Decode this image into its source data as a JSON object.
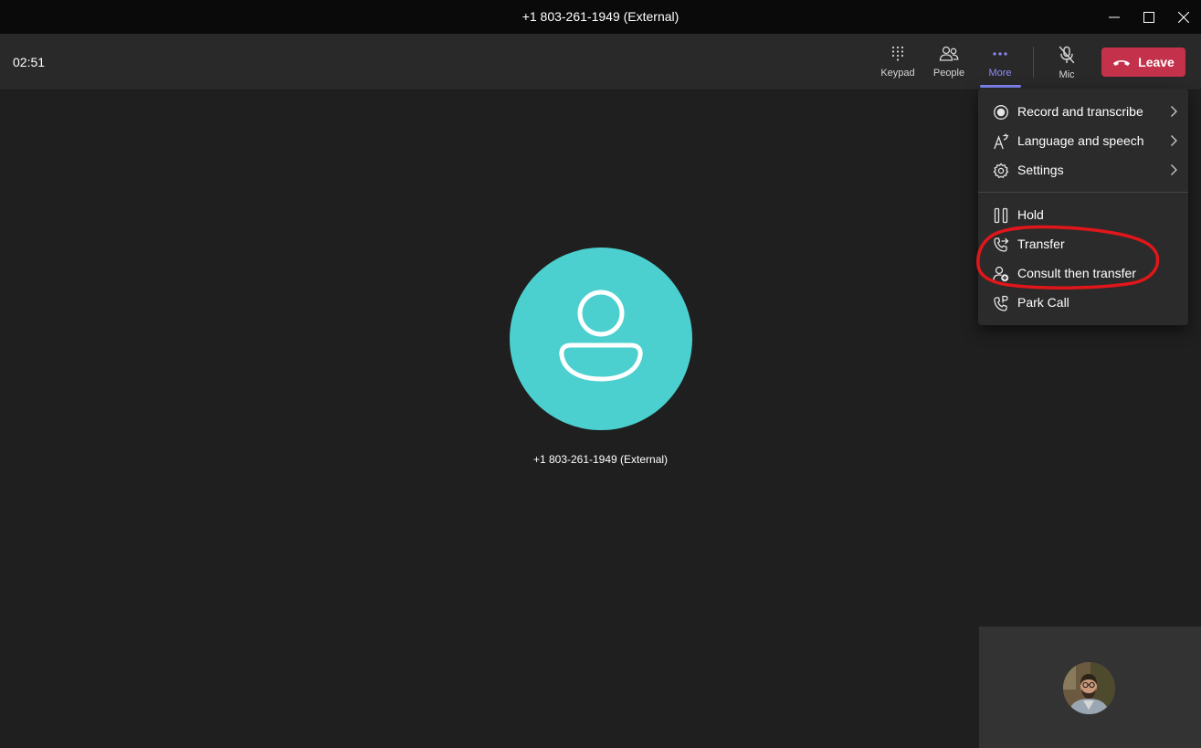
{
  "window": {
    "title": "+1 803-261-1949 (External)",
    "controls": [
      "minimize-icon",
      "maximize-icon",
      "close-icon"
    ]
  },
  "toolbar": {
    "timer": "02:51",
    "keypad_label": "Keypad",
    "people_label": "People",
    "more_label": "More",
    "mic_label": "Mic",
    "leave_label": "Leave",
    "accent_color": "#7f85f5",
    "leave_color": "#c4314b"
  },
  "stage": {
    "participant_name": "+1 803-261-1949 (External)",
    "avatar_color": "#4bd0cf"
  },
  "more_menu": {
    "items": [
      {
        "label": "Record and transcribe",
        "icon": "record-icon",
        "has_submenu": true
      },
      {
        "label": "Language and speech",
        "icon": "language-icon",
        "has_submenu": true
      },
      {
        "label": "Settings",
        "icon": "gear-icon",
        "has_submenu": true
      },
      {
        "label": "Hold",
        "icon": "pause-icon",
        "has_submenu": false
      },
      {
        "label": "Transfer",
        "icon": "transfer-icon",
        "has_submenu": false
      },
      {
        "label": "Consult then transfer",
        "icon": "consult-transfer-icon",
        "has_submenu": false
      },
      {
        "label": "Park Call",
        "icon": "park-call-icon",
        "has_submenu": false
      }
    ]
  },
  "annotation": {
    "color": "#e0161b"
  }
}
